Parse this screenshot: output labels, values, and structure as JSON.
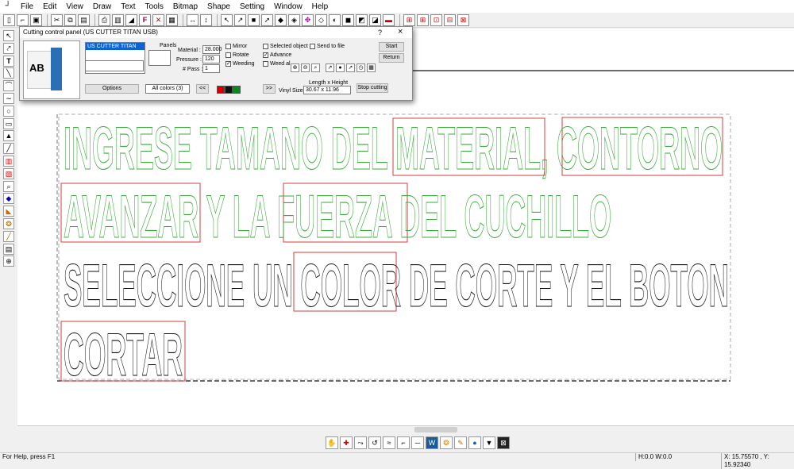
{
  "menu": {
    "items": [
      "File",
      "Edit",
      "View",
      "Draw",
      "Text",
      "Tools",
      "Bitmap",
      "Shape",
      "Setting",
      "Window",
      "Help"
    ]
  },
  "toolbar": {
    "icons": [
      "new-icon",
      "open-icon",
      "save-icon",
      "cut-icon",
      "copy-icon",
      "paste-icon",
      "print-icon",
      "cutter-icon",
      "font-icon",
      "text-f-icon",
      "delete-x-icon",
      "properties-icon",
      "width-icon",
      "height-icon",
      "pointer-icon",
      "node-edit-icon",
      "knife-icon",
      "select-icon",
      "eraser-icon",
      "fill-icon",
      "center-icon",
      "weld-icon",
      "group-icon",
      "ungroup-icon",
      "intersect-icon",
      "exclude-icon",
      "shadow-icon",
      "align-icon",
      "grid-icon",
      "mirror-icon",
      "rotate-icon",
      "flip-icon"
    ]
  },
  "dialog": {
    "title": "Cutting control panel  (US CUTTER TITAN  USB)",
    "help": "?",
    "close": "×",
    "logo_text": "AB",
    "cutter_selected": "US CUTTER TITAN",
    "panels_label": "Panels",
    "material_label": "Material :",
    "material_value": "28.000",
    "pressure_label": "Pressure :",
    "pressure_value": "120",
    "pass_label": "# Pass :",
    "pass_value": "1",
    "options": {
      "mirror": "Mirror",
      "rotate": "Rotate",
      "weeding": "Weeding",
      "selected": "Selected object",
      "advance": "Advance",
      "weed_all": "Weed al",
      "send_file": "Send to file"
    },
    "checks": {
      "mirror": false,
      "rotate": false,
      "weeding": true,
      "selected": false,
      "advance": true,
      "weed_all": false,
      "send_file": false
    },
    "start": "Start",
    "return": "Return",
    "options_btn": "Options",
    "colors_sel": "All colors (3)",
    "prev_btn": "<<",
    "next_btn": ">>",
    "vinyl_size_label": "Vinyl Size",
    "lxh_label": "Length x Height",
    "lxh_value": "30.67   x   11.96",
    "stop_cutting": "Stop cutting",
    "swatch_colors": [
      "#d40000",
      "#111111",
      "#0a8a1a"
    ]
  },
  "design": {
    "line1": "INGRESE TAMANO DEL MATERIAL, CONTORNO",
    "line2": "AVANZAR Y LA FUERZA DEL CUCHILLO",
    "line3": "SELECCIONE UN COLOR DE CORTE Y EL BOTON",
    "line4": "CORTAR",
    "colors": {
      "green": "#3aa83a",
      "black": "#111111",
      "red": "#d43c3c"
    }
  },
  "status": {
    "help": "For Help, press F1",
    "hw": "H:0.0   W:0.0",
    "xy": "X: 15.75570 , Y: 15.92340"
  }
}
